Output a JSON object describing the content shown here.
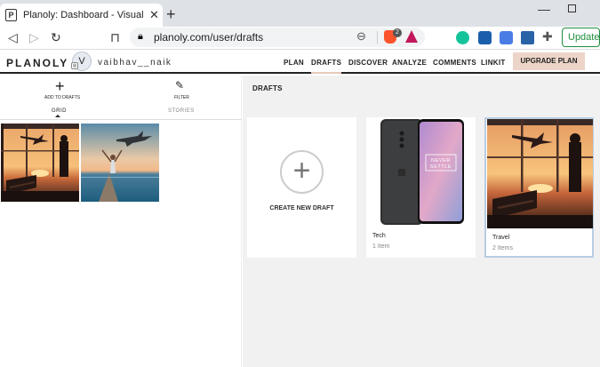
{
  "browser": {
    "tab_title": "Planoly: Dashboard - Visual plann",
    "favicon_letter": "P",
    "url": "planoly.com/user/drafts",
    "brave_badge": "2",
    "update_label": "Update"
  },
  "app": {
    "logo": "PLANOLY",
    "avatar_initial": "V",
    "username": "vaibhav__naik",
    "nav": [
      "PLAN",
      "DRAFTS",
      "DISCOVER",
      "ANALYZE",
      "COMMENTS",
      "LINKIT"
    ],
    "active_nav": "DRAFTS",
    "upgrade_label": "UPGRADE PLAN"
  },
  "left_panel": {
    "add_label": "ADD TO DRAFTS",
    "filter_label": "FILTER",
    "tabs": [
      "GRID",
      "STORIES"
    ],
    "active_tab": "GRID"
  },
  "right_panel": {
    "title": "DRAFTS",
    "create_label": "CREATE NEW DRAFT",
    "drafts": [
      {
        "name": "Tech",
        "count": "1 Item"
      },
      {
        "name": "Travel",
        "count": "2 Items"
      }
    ]
  },
  "colors": {
    "upgrade_bg": "#ecd5c8",
    "selected_border": "#b9cde3",
    "right_bg": "#f1f1f1"
  }
}
